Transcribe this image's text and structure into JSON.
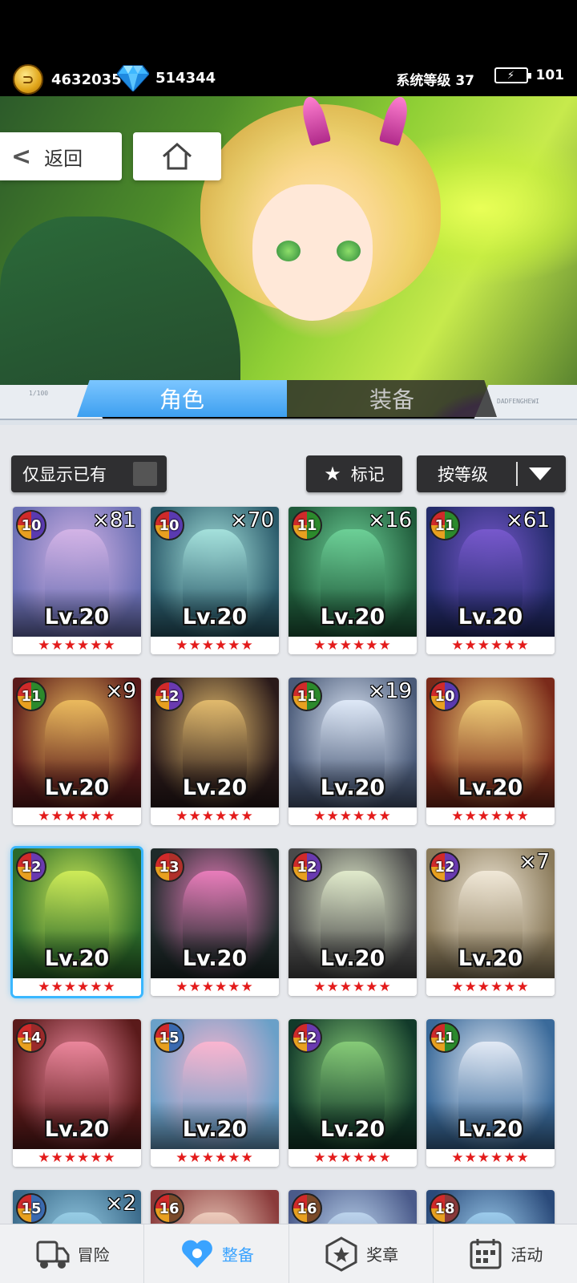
{
  "header": {
    "coins": "4632035",
    "gems": "514344",
    "system_level": "系统等级 37",
    "energy": "101"
  },
  "nav_buttons": {
    "back_label": "返回"
  },
  "tabs": [
    {
      "label": "角色",
      "active": true
    },
    {
      "label": "装备",
      "active": false
    }
  ],
  "deco": {
    "left_code": "1/100",
    "right_code": "DADFENGHEWI"
  },
  "filters": {
    "owned_only_label": "仅显示已有",
    "mark_label": "标记",
    "sort_label": "按等级"
  },
  "cards": [
    {
      "rank": "10",
      "count": "×81",
      "level": "Lv.20",
      "stars": "★★★★★★",
      "theme": [
        "#6a6fb3",
        "#d7b6e8"
      ],
      "selected": false
    },
    {
      "rank": "10",
      "count": "×70",
      "level": "Lv.20",
      "stars": "★★★★★★",
      "theme": [
        "#2a5a6a",
        "#a9e6e0"
      ],
      "selected": false
    },
    {
      "rank": "11",
      "count": "×16",
      "level": "Lv.20",
      "stars": "★★★★★★",
      "theme": [
        "#1f5a3a",
        "#6fd49a"
      ],
      "selected": false
    },
    {
      "rank": "11",
      "count": "×61",
      "level": "Lv.20",
      "stars": "★★★★★★",
      "theme": [
        "#232b6a",
        "#7a5ad0"
      ],
      "selected": false
    },
    {
      "rank": "11",
      "count": "×9",
      "level": "Lv.20",
      "stars": "★★★★★★",
      "theme": [
        "#5a1a1a",
        "#f0c060"
      ],
      "selected": false
    },
    {
      "rank": "12",
      "count": "",
      "level": "Lv.20",
      "stars": "★★★★★★",
      "theme": [
        "#2a1a1a",
        "#e8c070"
      ],
      "selected": false
    },
    {
      "rank": "11",
      "count": "×19",
      "level": "Lv.20",
      "stars": "★★★★★★",
      "theme": [
        "#4a5a78",
        "#e4eefc"
      ],
      "selected": false
    },
    {
      "rank": "10",
      "count": "",
      "level": "Lv.20",
      "stars": "★★★★★★",
      "theme": [
        "#7a2a1a",
        "#f3d27a"
      ],
      "selected": false
    },
    {
      "rank": "12",
      "count": "",
      "level": "Lv.20",
      "stars": "★★★★★★",
      "theme": [
        "#2b6a2a",
        "#d4f05a"
      ],
      "selected": true
    },
    {
      "rank": "13",
      "count": "",
      "level": "Lv.20",
      "stars": "★★★★★★",
      "theme": [
        "#1e2a2a",
        "#f080c0"
      ],
      "selected": false
    },
    {
      "rank": "12",
      "count": "",
      "level": "Lv.20",
      "stars": "★★★★★★",
      "theme": [
        "#4a4a4a",
        "#e6f0d0"
      ],
      "selected": false
    },
    {
      "rank": "12",
      "count": "×7",
      "level": "Lv.20",
      "stars": "★★★★★★",
      "theme": [
        "#8a7a5a",
        "#f4ecdc"
      ],
      "selected": false
    },
    {
      "rank": "14",
      "count": "",
      "level": "Lv.20",
      "stars": "★★★★★★",
      "theme": [
        "#5a1a1a",
        "#f08aa0"
      ],
      "selected": false
    },
    {
      "rank": "15",
      "count": "",
      "level": "Lv.20",
      "stars": "★★★★★★",
      "theme": [
        "#6aa0c8",
        "#ffb6d0"
      ],
      "selected": false
    },
    {
      "rank": "12",
      "count": "",
      "level": "Lv.20",
      "stars": "★★★★★★",
      "theme": [
        "#123a2a",
        "#8ad07a"
      ],
      "selected": false
    },
    {
      "rank": "11",
      "count": "",
      "level": "Lv.20",
      "stars": "★★★★★★",
      "theme": [
        "#3a6a9a",
        "#e8eef8"
      ],
      "selected": false
    },
    {
      "rank": "15",
      "count": "×2",
      "level": "",
      "stars": "",
      "theme": [
        "#3a6a8a",
        "#9ad0e8"
      ],
      "selected": false
    },
    {
      "rank": "16",
      "count": "",
      "level": "",
      "stars": "",
      "theme": [
        "#8a3a3a",
        "#f0d0c0"
      ],
      "selected": false
    },
    {
      "rank": "16",
      "count": "",
      "level": "",
      "stars": "",
      "theme": [
        "#4a5a8a",
        "#c0d8f0"
      ],
      "selected": false
    },
    {
      "rank": "18",
      "count": "",
      "level": "",
      "stars": "",
      "theme": [
        "#2a4a7a",
        "#a0d0f0"
      ],
      "selected": false
    }
  ],
  "badge_colors": {
    "10": "#5a3ab0",
    "11": "#2c8a2c",
    "12": "#6a3ab0",
    "13": "#b0302a",
    "14": "#9a2a2a",
    "15": "#3a6ab0",
    "16": "#7a4a2a",
    "18": "#8a3a3a"
  },
  "bottom_nav": [
    {
      "label": "冒险",
      "icon": "truck-icon",
      "active": false
    },
    {
      "label": "整备",
      "icon": "heart-gear-icon",
      "active": true
    },
    {
      "label": "奖章",
      "icon": "medal-icon",
      "active": false
    },
    {
      "label": "活动",
      "icon": "calendar-icon",
      "active": false
    }
  ],
  "colors": {
    "accent": "#3aa3ff",
    "star_red": "#e31b1b"
  }
}
